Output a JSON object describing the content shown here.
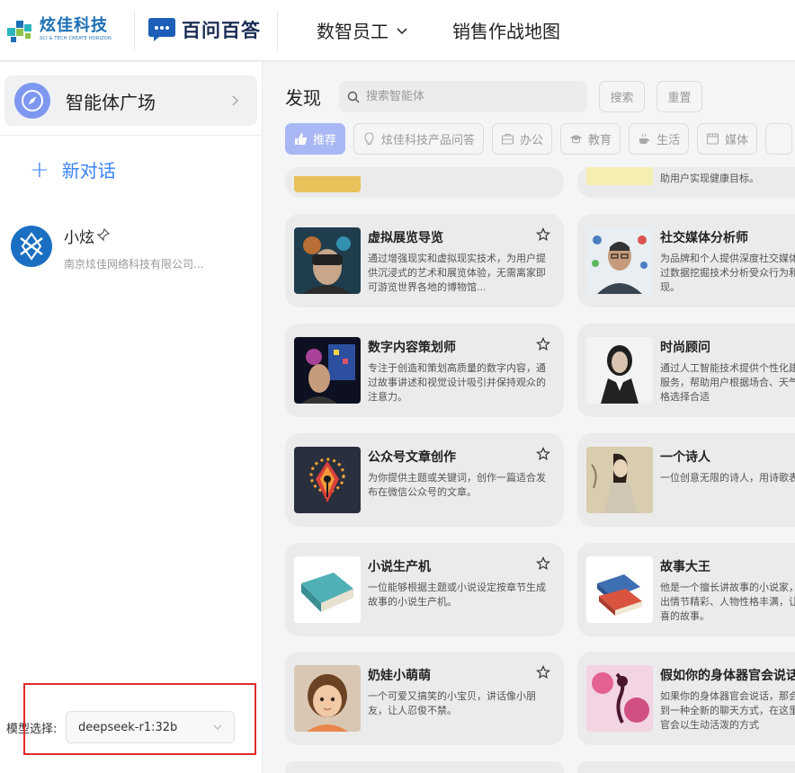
{
  "header": {
    "brand1_name": "炫佳科技",
    "brand1_sub": "SCI & TECH CREATE HORIZON",
    "brand2_name": "百问百答",
    "nav_items": [
      {
        "label": "数智员工",
        "has_dropdown": true
      },
      {
        "label": "销售作战地图",
        "has_dropdown": false
      }
    ]
  },
  "sidebar": {
    "square_label": "智能体广场",
    "new_chat_label": "新对话",
    "agent": {
      "name": "小炫",
      "company": "南京炫佳网络科技有限公司..."
    },
    "model_label": "模型选择:",
    "model_value": "deepseek-r1:32b"
  },
  "main": {
    "title": "发现",
    "search_placeholder": "搜索智能体",
    "search_button": "搜索",
    "reset_button": "重置",
    "categories": [
      {
        "label": "推荐",
        "icon": "thumbs-up-icon",
        "active": true
      },
      {
        "label": "炫佳科技产品问答",
        "icon": "bulb-icon",
        "active": false
      },
      {
        "label": "办公",
        "icon": "briefcase-icon",
        "active": false
      },
      {
        "label": "教育",
        "icon": "graduation-cap-icon",
        "active": false
      },
      {
        "label": "生活",
        "icon": "coffee-icon",
        "active": false
      },
      {
        "label": "媒体",
        "icon": "media-icon",
        "active": false
      }
    ],
    "partial_top_right_desc": "助用户实现健康目标。",
    "cards_left": [
      {
        "name": "虚拟展览导览",
        "desc": "通过增强现实和虚拟现实技术，为用户提供沉浸式的艺术和展览体验，无需离家即可游览世界各地的博物馆..."
      },
      {
        "name": "数字内容策划师",
        "desc": "专注于创造和策划高质量的数字内容，通过故事讲述和视觉设计吸引并保持观众的注意力。"
      },
      {
        "name": "公众号文章创作",
        "desc": "为你提供主题或关键词，创作一篇适合发布在微信公众号的文章。"
      },
      {
        "name": "小说生产机",
        "desc": "一位能够根据主题或小说设定按章节生成故事的小说生产机。"
      },
      {
        "name": "奶娃小萌萌",
        "desc": "一个可爱又搞笑的小宝贝，讲话像小朋友，让人忍俊不禁。"
      }
    ],
    "cards_right": [
      {
        "name": "社交媒体分析师",
        "desc": "为品牌和个人提供深度社交媒体服务，通过数据挖掘技术分析受众行为和内容表现。"
      },
      {
        "name": "时尚顾问",
        "desc": "通过人工智能技术提供个性化建议和搭配服务，帮助用户根据场合、天气和个人风格选择合适"
      },
      {
        "name": "一个诗人",
        "desc": "一位创意无限的诗人，用诗歌表达一切。"
      },
      {
        "name": "故事大王",
        "desc": "他是一个擅长讲故事的小说家，他总是写出情节精彩、人物性格丰满，让读者潮惊喜的故事。"
      },
      {
        "name": "假如你的身体器官会说话",
        "desc": "如果你的身体器官会说话，那会让你体验到一种全新的聊天方式，在这里，你的器官会以生动活泼的方式"
      }
    ]
  },
  "colors": {
    "accent_blue": "#3b82f6",
    "active_category": "#a9b8f4",
    "highlight_box": "#e02a2a"
  }
}
